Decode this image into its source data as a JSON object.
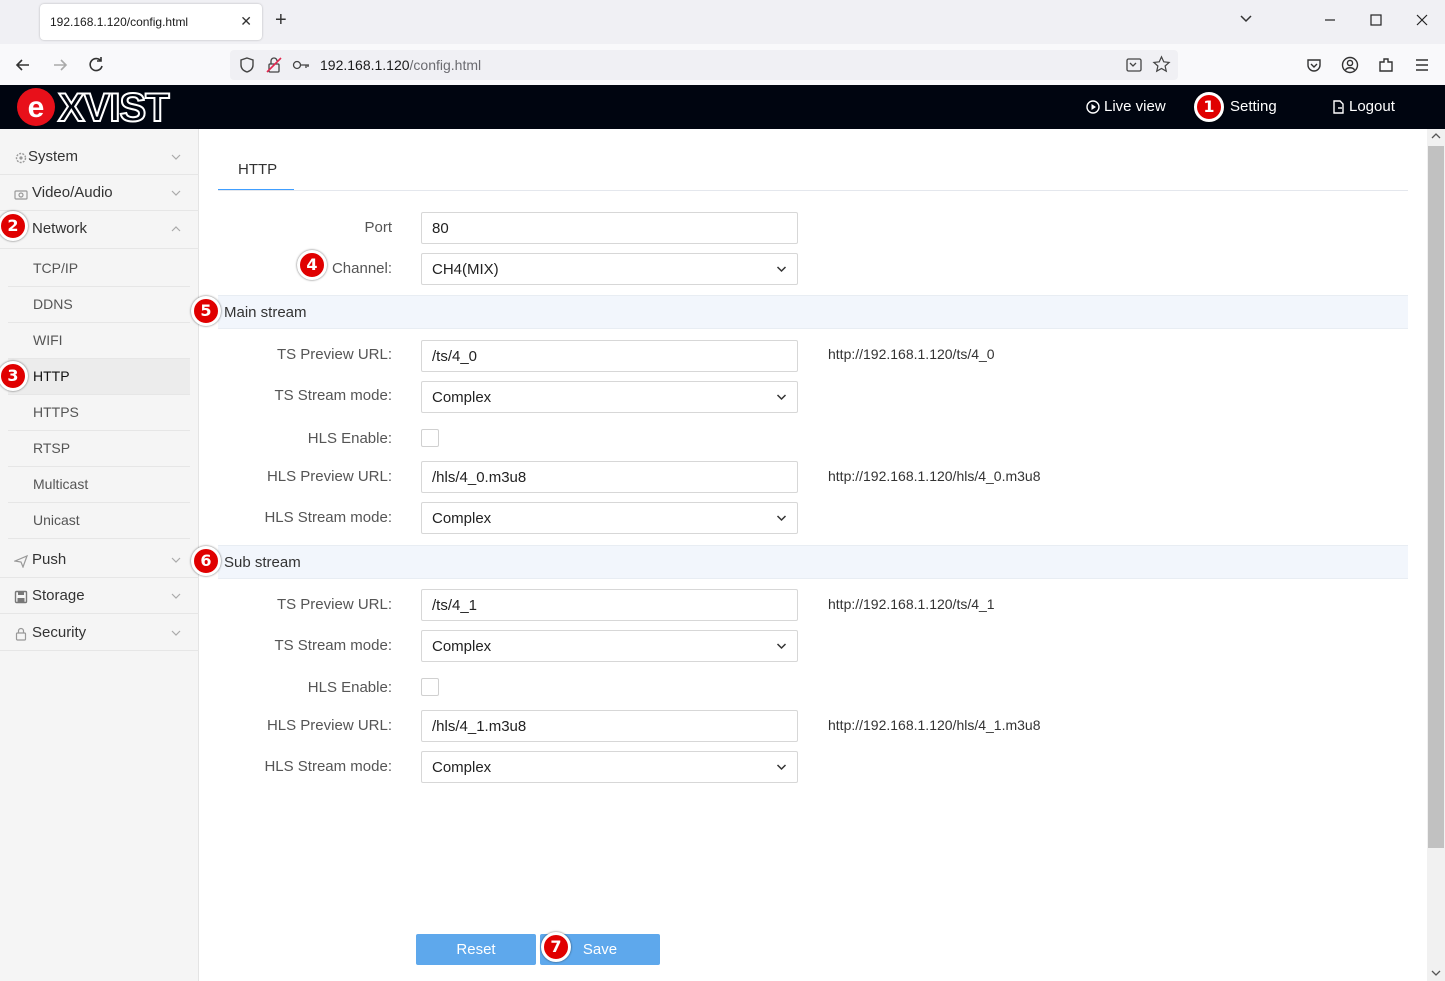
{
  "browser": {
    "tab_title": "192.168.1.120/config.html",
    "url_host": "192.168.1.120",
    "url_path": "/config.html",
    "tab_close_glyph": "✕",
    "new_tab_glyph": "+"
  },
  "header": {
    "logo_text": "exvist",
    "live_view": "Live view",
    "setting": "Setting",
    "logout": "Logout",
    "accent_color": "#000510"
  },
  "sidebar": {
    "system": "System",
    "video_audio": "Video/Audio",
    "network": "Network",
    "network_sub": [
      "TCP/IP",
      "DDNS",
      "WIFI",
      "HTTP",
      "HTTPS",
      "RTSP",
      "Multicast",
      "Unicast"
    ],
    "push": "Push",
    "storage": "Storage",
    "security": "Security"
  },
  "content": {
    "tab": "HTTP",
    "port_label": "Port",
    "port_value": "80",
    "channel_label": "Channel:",
    "channel_value": "CH4(MIX)",
    "main": {
      "title": "Main stream",
      "ts_url_label": "TS Preview URL:",
      "ts_url_value": "/ts/4_0",
      "ts_url_full": "http://192.168.1.120/ts/4_0",
      "ts_mode_label": "TS Stream mode:",
      "ts_mode_value": "Complex",
      "hls_enable_label": "HLS Enable:",
      "hls_url_label": "HLS Preview URL:",
      "hls_url_value": "/hls/4_0.m3u8",
      "hls_url_full": "http://192.168.1.120/hls/4_0.m3u8",
      "hls_mode_label": "HLS Stream mode:",
      "hls_mode_value": "Complex"
    },
    "sub": {
      "title": "Sub stream",
      "ts_url_label": "TS Preview URL:",
      "ts_url_value": "/ts/4_1",
      "ts_url_full": "http://192.168.1.120/ts/4_1",
      "ts_mode_label": "TS Stream mode:",
      "ts_mode_value": "Complex",
      "hls_enable_label": "HLS Enable:",
      "hls_url_label": "HLS Preview URL:",
      "hls_url_value": "/hls/4_1.m3u8",
      "hls_url_full": "http://192.168.1.120/hls/4_1.m3u8",
      "hls_mode_label": "HLS Stream mode:",
      "hls_mode_value": "Complex"
    },
    "reset": "Reset",
    "save": "Save"
  },
  "markers": [
    "1",
    "2",
    "3",
    "4",
    "5",
    "6",
    "7"
  ]
}
